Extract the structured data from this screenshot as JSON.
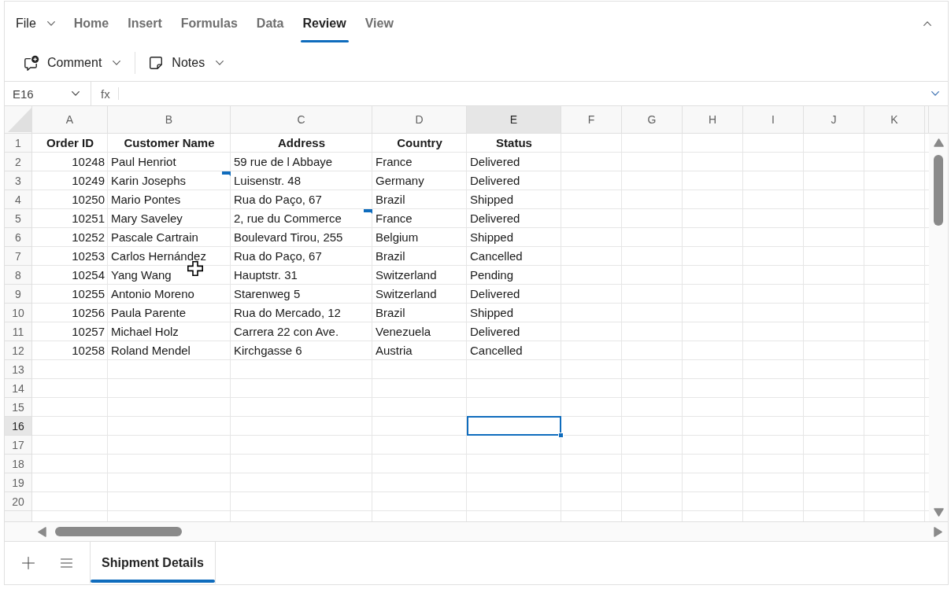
{
  "ribbon": {
    "file_menu": {
      "label": "File"
    },
    "tabs": [
      {
        "label": "Home",
        "selected": false
      },
      {
        "label": "Insert",
        "selected": false
      },
      {
        "label": "Formulas",
        "selected": false
      },
      {
        "label": "Data",
        "selected": false
      },
      {
        "label": "Review",
        "selected": true
      },
      {
        "label": "View",
        "selected": false
      }
    ]
  },
  "toolbar": {
    "buttons": [
      {
        "label": "Comment",
        "kind": "comment"
      },
      {
        "label": "Notes",
        "kind": "notes"
      }
    ]
  },
  "formula_bar": {
    "name_box": {
      "value": "E16"
    },
    "function_label": "fx"
  },
  "grid": {
    "columns": [
      {
        "label": "A",
        "selected": false
      },
      {
        "label": "B",
        "selected": false
      },
      {
        "label": "C",
        "selected": false
      },
      {
        "label": "D",
        "selected": false
      },
      {
        "label": "E",
        "selected": true
      },
      {
        "label": "F",
        "selected": false
      },
      {
        "label": "G",
        "selected": false
      },
      {
        "label": "H",
        "selected": false
      },
      {
        "label": "I",
        "selected": false
      },
      {
        "label": "J",
        "selected": false
      },
      {
        "label": "K",
        "selected": false
      }
    ],
    "rows": [
      {
        "label": "1",
        "selected": false,
        "cells": [
          {
            "text": "Order ID",
            "kind": "header",
            "note": false
          },
          {
            "text": "Customer Name",
            "kind": "header",
            "note": false
          },
          {
            "text": "Address",
            "kind": "header",
            "note": false
          },
          {
            "text": "Country",
            "kind": "header",
            "note": false
          },
          {
            "text": "Status",
            "kind": "header",
            "note": false
          }
        ]
      },
      {
        "label": "2",
        "selected": false,
        "cells": [
          {
            "text": "10248",
            "kind": "number",
            "note": false
          },
          {
            "text": "Paul Henriot",
            "kind": "text",
            "note": false
          },
          {
            "text": "59 rue de l Abbaye",
            "kind": "text",
            "note": false
          },
          {
            "text": "France",
            "kind": "text",
            "note": false
          },
          {
            "text": "Delivered",
            "kind": "text",
            "note": false
          }
        ]
      },
      {
        "label": "3",
        "selected": false,
        "cells": [
          {
            "text": "10249",
            "kind": "number",
            "note": false
          },
          {
            "text": "Karin Josephs",
            "kind": "text",
            "note": true
          },
          {
            "text": "Luisenstr. 48",
            "kind": "text",
            "note": false
          },
          {
            "text": "Germany",
            "kind": "text",
            "note": false
          },
          {
            "text": "Delivered",
            "kind": "text",
            "note": false
          }
        ]
      },
      {
        "label": "4",
        "selected": false,
        "cells": [
          {
            "text": "10250",
            "kind": "number",
            "note": false
          },
          {
            "text": "Mario Pontes",
            "kind": "text",
            "note": false
          },
          {
            "text": "Rua do Paço, 67",
            "kind": "text",
            "note": false
          },
          {
            "text": "Brazil",
            "kind": "text",
            "note": false
          },
          {
            "text": "Shipped",
            "kind": "text",
            "note": false
          }
        ]
      },
      {
        "label": "5",
        "selected": false,
        "cells": [
          {
            "text": "10251",
            "kind": "number",
            "note": false
          },
          {
            "text": "Mary Saveley",
            "kind": "text",
            "note": false
          },
          {
            "text": "2, rue du Commerce",
            "kind": "text",
            "note": true
          },
          {
            "text": "France",
            "kind": "text",
            "note": false
          },
          {
            "text": "Delivered",
            "kind": "text",
            "note": false
          }
        ]
      },
      {
        "label": "6",
        "selected": false,
        "cells": [
          {
            "text": "10252",
            "kind": "number",
            "note": false
          },
          {
            "text": "Pascale Cartrain",
            "kind": "text",
            "note": false
          },
          {
            "text": "Boulevard Tirou, 255",
            "kind": "text",
            "note": false
          },
          {
            "text": "Belgium",
            "kind": "text",
            "note": false
          },
          {
            "text": "Shipped",
            "kind": "text",
            "note": false
          }
        ]
      },
      {
        "label": "7",
        "selected": false,
        "cells": [
          {
            "text": "10253",
            "kind": "number",
            "note": false
          },
          {
            "text": "Carlos Hernández",
            "kind": "text",
            "note": false
          },
          {
            "text": "Rua do Paço, 67",
            "kind": "text",
            "note": false
          },
          {
            "text": "Brazil",
            "kind": "text",
            "note": false
          },
          {
            "text": "Cancelled",
            "kind": "text",
            "note": false
          }
        ]
      },
      {
        "label": "8",
        "selected": false,
        "cells": [
          {
            "text": "10254",
            "kind": "number",
            "note": false
          },
          {
            "text": "Yang Wang",
            "kind": "text",
            "note": false
          },
          {
            "text": "Hauptstr. 31",
            "kind": "text",
            "note": false
          },
          {
            "text": "Switzerland",
            "kind": "text",
            "note": false
          },
          {
            "text": "Pending",
            "kind": "text",
            "note": false
          }
        ]
      },
      {
        "label": "9",
        "selected": false,
        "cells": [
          {
            "text": "10255",
            "kind": "number",
            "note": false
          },
          {
            "text": "Antonio Moreno",
            "kind": "text",
            "note": false
          },
          {
            "text": "Starenweg 5",
            "kind": "text",
            "note": false
          },
          {
            "text": "Switzerland",
            "kind": "text",
            "note": false
          },
          {
            "text": "Delivered",
            "kind": "text",
            "note": false
          }
        ]
      },
      {
        "label": "10",
        "selected": false,
        "cells": [
          {
            "text": "10256",
            "kind": "number",
            "note": false
          },
          {
            "text": "Paula Parente",
            "kind": "text",
            "note": false
          },
          {
            "text": "Rua do Mercado, 12",
            "kind": "text",
            "note": false
          },
          {
            "text": "Brazil",
            "kind": "text",
            "note": false
          },
          {
            "text": "Shipped",
            "kind": "text",
            "note": false
          }
        ]
      },
      {
        "label": "11",
        "selected": false,
        "cells": [
          {
            "text": "10257",
            "kind": "number",
            "note": false
          },
          {
            "text": "Michael Holz",
            "kind": "text",
            "note": false
          },
          {
            "text": "Carrera 22 con Ave.",
            "kind": "text",
            "note": false
          },
          {
            "text": "Venezuela",
            "kind": "text",
            "note": false
          },
          {
            "text": "Delivered",
            "kind": "text",
            "note": false
          }
        ]
      },
      {
        "label": "12",
        "selected": false,
        "cells": [
          {
            "text": "10258",
            "kind": "number",
            "note": false
          },
          {
            "text": "Roland Mendel",
            "kind": "text",
            "note": false
          },
          {
            "text": "Kirchgasse 6",
            "kind": "text",
            "note": false
          },
          {
            "text": "Austria",
            "kind": "text",
            "note": false
          },
          {
            "text": "Cancelled",
            "kind": "text",
            "note": false
          }
        ]
      },
      {
        "label": "13",
        "selected": false
      },
      {
        "label": "14",
        "selected": false
      },
      {
        "label": "15",
        "selected": false
      },
      {
        "label": "16",
        "selected": true
      },
      {
        "label": "17",
        "selected": false
      },
      {
        "label": "18",
        "selected": false
      },
      {
        "label": "19",
        "selected": false
      },
      {
        "label": "20",
        "selected": false
      }
    ]
  },
  "sheet_tabs": {
    "tabs": [
      {
        "label": "Shipment Details",
        "selected": true
      }
    ]
  }
}
